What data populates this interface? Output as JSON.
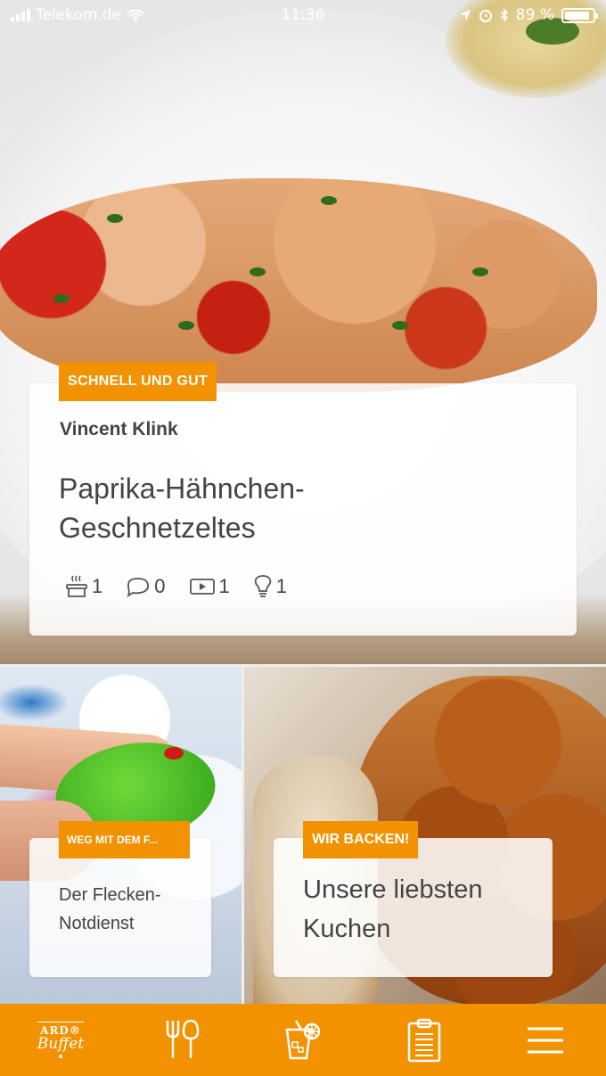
{
  "status_bar": {
    "carrier": "Telekom.de",
    "time": "11:36",
    "battery": "89 %",
    "battery_level": 0.89
  },
  "hero": {
    "tag": "SCHNELL UND GUT",
    "author": "Vincent Klink",
    "title": "Paprika-Hähnchen-Geschnetzeltes",
    "stats": {
      "cooking": "1",
      "comments": "0",
      "videos": "1",
      "tips": "1"
    }
  },
  "tiles": [
    {
      "tag": "WEG MIT DEM F...",
      "title": "Der Flecken-Notdienst"
    },
    {
      "tag": "WIR BACKEN!",
      "title": "Unsere liebsten Kuchen"
    }
  ],
  "nav": {
    "logo_top": "ARD®",
    "logo_bottom": "Buffet",
    "items": [
      "logo",
      "recipes-icon",
      "drinks-icon",
      "shopping-list-icon",
      "menu-icon"
    ]
  },
  "colors": {
    "accent": "#f39200",
    "text": "#444444",
    "card": "#ffffff"
  }
}
